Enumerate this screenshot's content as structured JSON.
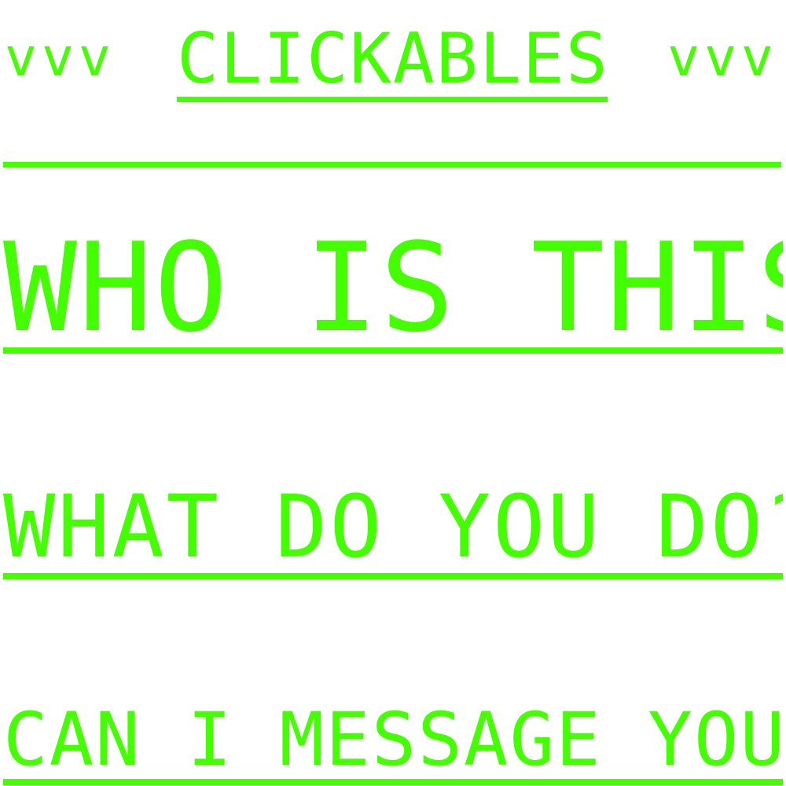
{
  "header": {
    "arrows_left": "vvv",
    "title": "CLICKABLES",
    "arrows_right": "vvv"
  },
  "links": [
    {
      "label": "WHO IS THIS?"
    },
    {
      "label": "WHAT DO YOU DO?"
    },
    {
      "label": "CAN I MESSAGE YOU?"
    }
  ],
  "colors": {
    "accent": "#44ff00",
    "background": "#ffffff"
  }
}
